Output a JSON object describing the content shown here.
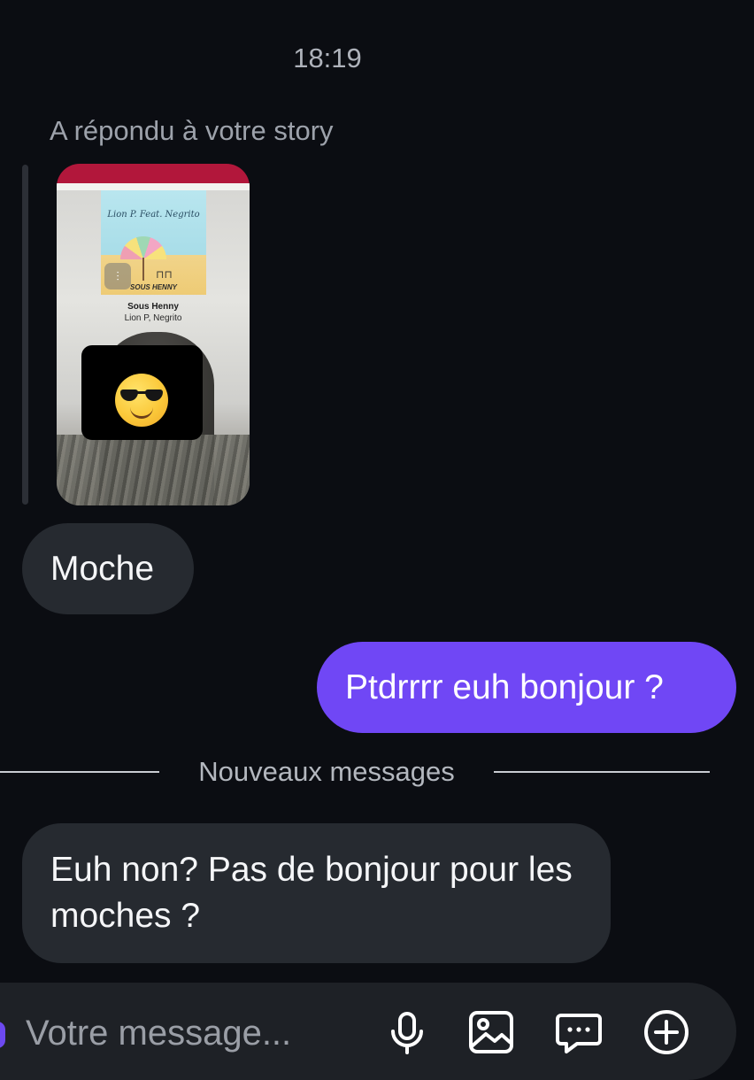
{
  "conversation": {
    "timestamp": "18:19",
    "story_reply_label": "A répondu à votre story",
    "story_preview": {
      "album_title": "Lion P. Feat. Negrito",
      "album_subtitle": "SOUS HENNY",
      "song_title": "Sous Henny",
      "song_artist": "Lion P, Negrito",
      "sticker_icon": "sunglasses-emoji"
    },
    "messages": [
      {
        "direction": "incoming",
        "text": "Moche"
      },
      {
        "direction": "outgoing",
        "text": "Ptdrrrr euh bonjour ?"
      },
      {
        "direction": "incoming",
        "text": "Euh non? Pas de bonjour pour les moches ?"
      }
    ],
    "new_messages_divider": "Nouveaux messages"
  },
  "composer": {
    "placeholder": "Votre message...",
    "icons": [
      "microphone-icon",
      "image-icon",
      "chat-bubble-icon",
      "plus-circle-icon"
    ]
  },
  "colors": {
    "background": "#0b0d12",
    "incoming_bubble": "#262a30",
    "outgoing_bubble": "#7047f5",
    "composer": "#1e2126"
  }
}
